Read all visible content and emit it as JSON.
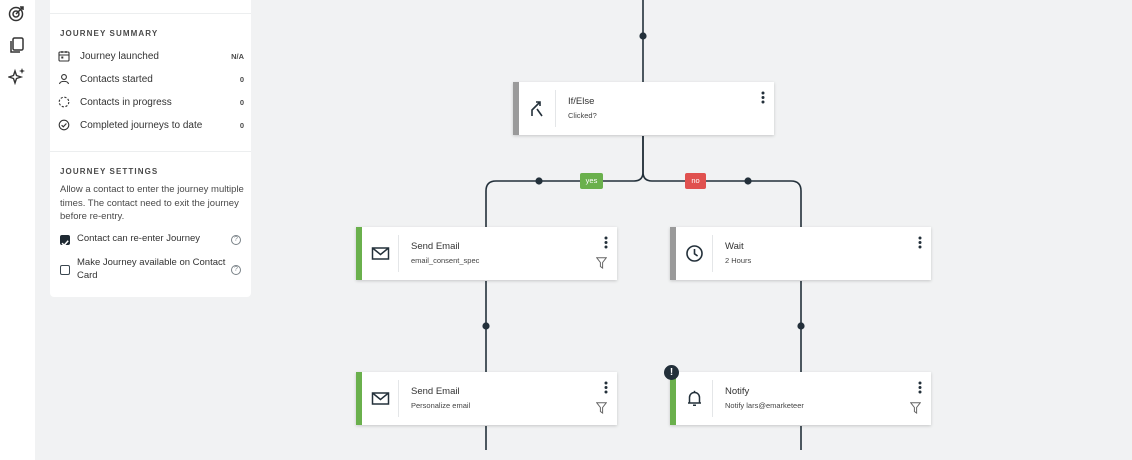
{
  "summary": {
    "title": "JOURNEY SUMMARY",
    "rows": [
      {
        "label": "Journey launched",
        "value": "N/A",
        "icon": "calendar-icon"
      },
      {
        "label": "Contacts started",
        "value": "0",
        "icon": "user-icon"
      },
      {
        "label": "Contacts in progress",
        "value": "0",
        "icon": "progress-icon"
      },
      {
        "label": "Completed journeys to date",
        "value": "0",
        "icon": "check-circle-icon"
      }
    ]
  },
  "settings": {
    "title": "JOURNEY SETTINGS",
    "description": "Allow a contact to enter the journey multiple times. The contact need to exit the journey before re-entry.",
    "options": [
      {
        "label": "Contact can re-enter Journey",
        "checked": true
      },
      {
        "label": "Make Journey available on Contact Card",
        "checked": false
      }
    ]
  },
  "nodes": [
    {
      "title": "If/Else",
      "subtitle": "Clicked?",
      "icon": "split-icon",
      "status": "inactive"
    },
    {
      "title": "Send Email",
      "subtitle": "email_consent_spec",
      "icon": "envelope-icon",
      "status": "active"
    },
    {
      "title": "Wait",
      "subtitle": "2 Hours",
      "icon": "clock-icon",
      "status": "inactive"
    },
    {
      "title": "Send Email",
      "subtitle": "Personalize email",
      "icon": "envelope-icon",
      "status": "active"
    },
    {
      "title": "Notify",
      "subtitle": "Notify lars@emarketeer",
      "icon": "bell-icon",
      "status": "active"
    }
  ],
  "branches": {
    "yes": "yes",
    "no": "no"
  },
  "warning_glyph": "!",
  "colors": {
    "active": "#6ab04c",
    "inactive": "#9a9a9a",
    "yes": "#6ab04c",
    "no": "#e0514f",
    "connector": "#23303a",
    "canvas": "#f1f2f3"
  }
}
